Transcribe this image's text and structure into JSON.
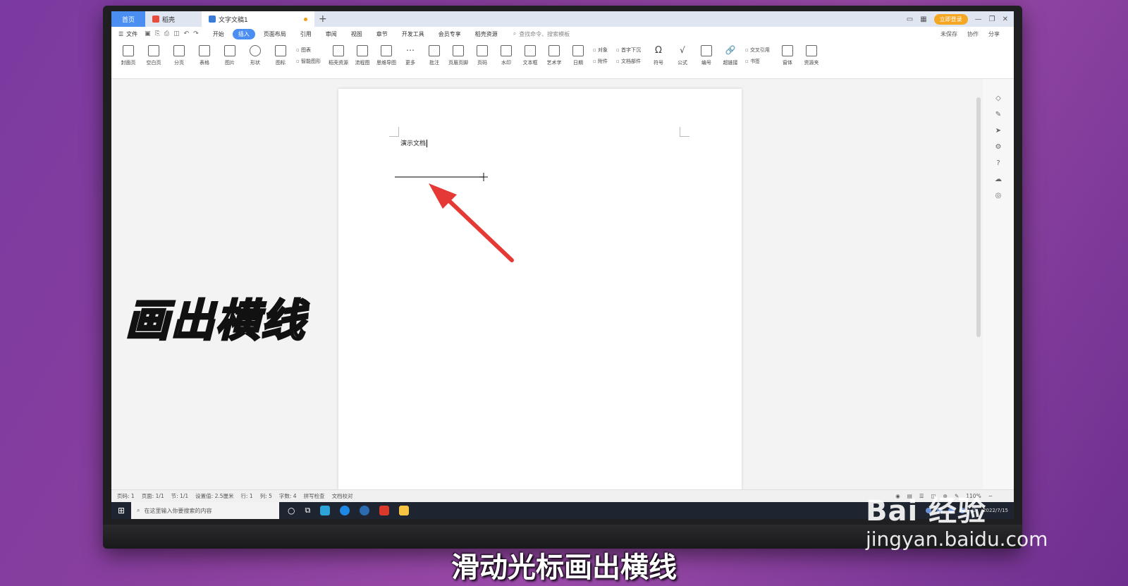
{
  "titlebar": {
    "tab_home": "首页",
    "tab_wps": "稻壳",
    "tab_doc": "文字文稿1",
    "new_tab": "+",
    "login": "立即登录"
  },
  "menu": {
    "file": "文件",
    "items": [
      "开始",
      "插入",
      "页面布局",
      "引用",
      "审阅",
      "视图",
      "章节",
      "开发工具",
      "会员专享",
      "稻壳资源"
    ],
    "active_index": 1,
    "search_placeholder": "查找命令、搜索模板",
    "right": [
      "未保存",
      "协作",
      "分享"
    ]
  },
  "ribbon": {
    "buttons": [
      "封面页",
      "空白页",
      "分页",
      "表格",
      "图片",
      "形状",
      "图标"
    ],
    "stack1": [
      "图表",
      "智能图形"
    ],
    "buttons2": [
      "稻壳资源",
      "流程图",
      "思维导图",
      "更多",
      "批注",
      "页眉页脚",
      "页码",
      "水印",
      "文本框",
      "艺术字",
      "日期"
    ],
    "stack2": [
      "对象",
      "附件"
    ],
    "stack3": [
      "首字下沉",
      "文档部件"
    ],
    "buttons3": [
      "符号",
      "公式",
      "编号",
      "超链接"
    ],
    "stack4": [
      "交叉引用",
      "书签"
    ],
    "buttons4": [
      "窗体",
      "资源夹"
    ]
  },
  "document": {
    "text": "演示文档"
  },
  "statusbar": {
    "items": [
      "页码: 1",
      "页面: 1/1",
      "节: 1/1",
      "设置值: 2.5厘米",
      "行: 1",
      "列: 5",
      "字数: 4",
      "拼写检查",
      "文档校对"
    ],
    "zoom": "110%"
  },
  "taskbar": {
    "search_placeholder": "在这里输入你要搜索的内容",
    "date": "2022/7/15"
  },
  "overlay": {
    "caption": "画出横线",
    "subtitle": "滑动光标画出横线",
    "watermark_logo": "Bai 经验",
    "watermark_url": "jingyan.baidu.com"
  }
}
